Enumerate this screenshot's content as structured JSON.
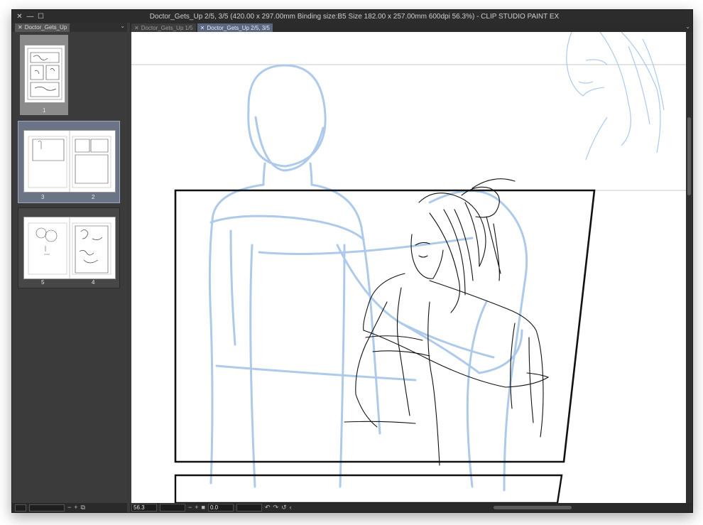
{
  "window": {
    "title": "Doctor_Gets_Up 2/5, 3/5 (420.00 x 297.00mm Binding size:B5 Size 182.00 x 257.00mm 600dpi 56.3%)  - CLIP STUDIO PAINT EX",
    "controls": [
      "✕",
      "—",
      "☐"
    ]
  },
  "left_panel": {
    "tab_label": "Doctor_Gets_Up",
    "pages": [
      {
        "labels": [
          "1"
        ],
        "selected": false
      },
      {
        "labels": [
          "3",
          "2"
        ],
        "selected": true
      },
      {
        "labels": [
          "5",
          "4"
        ],
        "selected": false
      }
    ]
  },
  "doc_tabs": [
    {
      "label": "Doctor_Gets_Up 1/5",
      "active": false
    },
    {
      "label": "Doctor_Gets_Up 2/5, 3/5",
      "active": true
    }
  ],
  "status": {
    "zoom": "56.3",
    "rotation": "0.0"
  },
  "colors": {
    "sketch_blue": "#a9c8ea",
    "ink": "#111111",
    "active_tab": "#5b6780"
  }
}
